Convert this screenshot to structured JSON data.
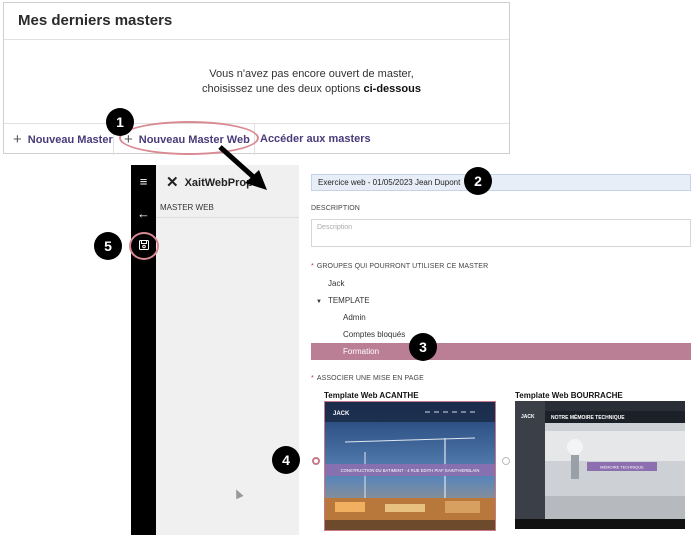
{
  "card": {
    "title": "Mes derniers masters",
    "message_line1": "Vous n'avez pas encore ouvert de master,",
    "message_line2_prefix": "choisissez une des deux options ",
    "message_line2_bold": "ci-dessous",
    "buttons": {
      "new_master": "Nouveau Master",
      "new_master_web": "Nouveau Master Web",
      "access_masters": "Accéder aux masters"
    },
    "plus_icon": "+"
  },
  "app": {
    "brand": "XaitWebPrope",
    "nav_label": "MASTER WEB",
    "rail_icons": {
      "menu": "≡",
      "back": "←",
      "save": "save-icon"
    },
    "title_value": "Exercice web - 01/05/2023 Jean Dupont",
    "description_label": "DESCRIPTION",
    "description_placeholder": "Description",
    "groups_label": "GROUPES QUI POURRONT UTILISER CE MASTER",
    "required_mark": "*",
    "tree": {
      "jack": "Jack",
      "template": "TEMPLATE",
      "caret": "▼",
      "admin": "Admin",
      "blocked": "Comptes bloqués",
      "training": "Formation"
    },
    "layout_label": "ASSOCIER UNE MISE EN PAGE",
    "templates": [
      {
        "name": "Template Web ACANTHE",
        "selected": true,
        "banner": "CONSTRUCTION DU BATIMENT - 4 RUE EDITH PIAF SAINT-HERBLAIN",
        "logo": "JACK"
      },
      {
        "name": "Template Web BOURRACHE",
        "selected": false,
        "header": "NOTRE MÉMOIRE TECHNIQUE",
        "button": "MÉMOIRE TECHNIQUE",
        "logo": "JACK"
      }
    ],
    "selection_color": "#bb7f95"
  },
  "annotations": {
    "n1": "1",
    "n2": "2",
    "n3": "3",
    "n4": "4",
    "n5": "5"
  }
}
